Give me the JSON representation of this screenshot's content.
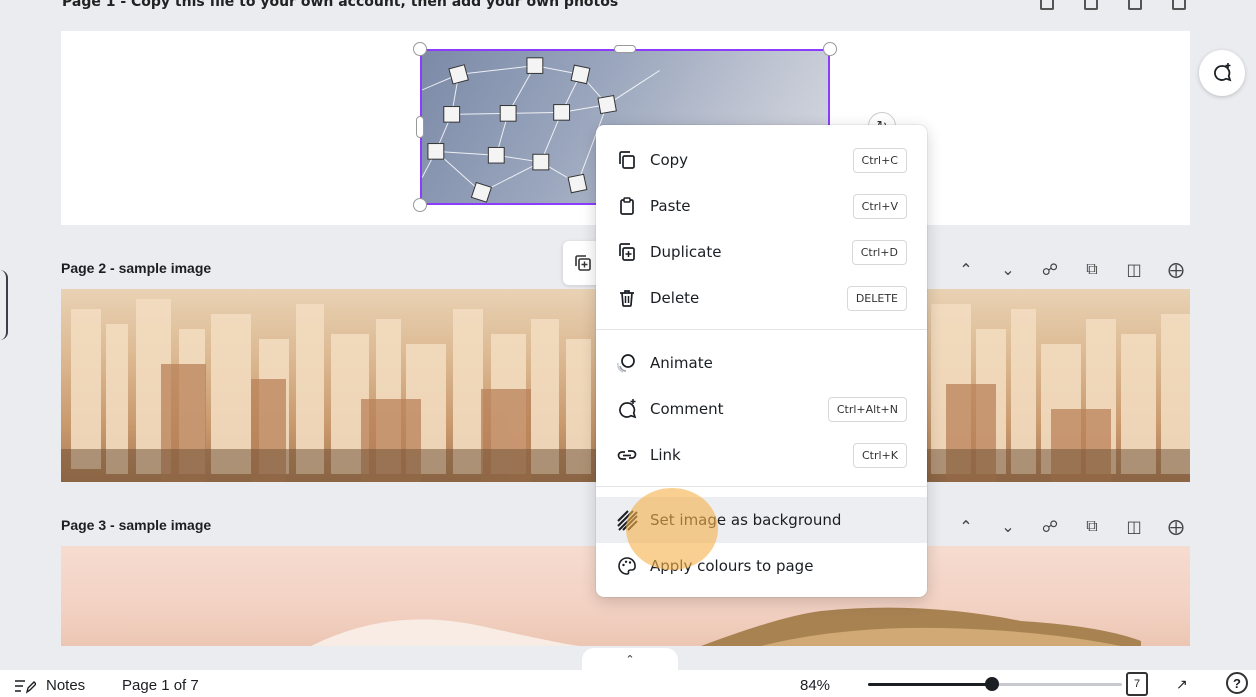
{
  "pages": {
    "page1_title": "Page 1 - Copy this file to your own account, then add your own photos",
    "page2_title": "Page 2 - sample image",
    "page3_title": "Page 3 - sample image"
  },
  "context_menu": {
    "items": [
      {
        "label": "Copy",
        "shortcut": "Ctrl+C",
        "icon": "copy-icon"
      },
      {
        "label": "Paste",
        "shortcut": "Ctrl+V",
        "icon": "paste-icon"
      },
      {
        "label": "Duplicate",
        "shortcut": "Ctrl+D",
        "icon": "duplicate-icon"
      },
      {
        "label": "Delete",
        "shortcut": "DELETE",
        "icon": "trash-icon"
      },
      {
        "label": "Animate",
        "shortcut": "",
        "icon": "animate-icon"
      },
      {
        "label": "Comment",
        "shortcut": "Ctrl+Alt+N",
        "icon": "comment-icon"
      },
      {
        "label": "Link",
        "shortcut": "Ctrl+K",
        "icon": "link-icon"
      },
      {
        "label": "Set image as background",
        "shortcut": "",
        "icon": "background-icon"
      },
      {
        "label": "Apply colours to page",
        "shortcut": "",
        "icon": "palette-icon"
      }
    ]
  },
  "footer": {
    "notes_label": "Notes",
    "page_indicator": "Page 1 of 7",
    "zoom_label": "84%",
    "zoom_value": 0.49,
    "page_count_badge": "7",
    "help_label": "?"
  },
  "colors": {
    "selection": "#8b3dff",
    "highlight": "#eceef2",
    "cursor": "#f5b048"
  }
}
